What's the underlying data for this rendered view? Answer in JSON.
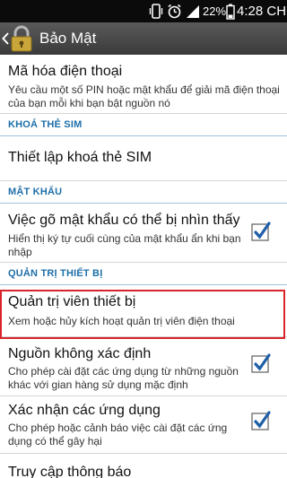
{
  "status_bar": {
    "battery": "22%",
    "time": "4:28 CH"
  },
  "action_bar": {
    "title": "Bảo Mật"
  },
  "items": {
    "encrypt": {
      "title": "Mã hóa điện thoại",
      "subtitle": "Yêu cầu một số PIN hoặc mật khẩu để giải mã điện thoại của bạn mỗi khi bạn bật nguồn nó"
    },
    "sim_header": "KHOÁ THẺ SIM",
    "sim_lock": {
      "title": "Thiết lập khoá thẻ SIM"
    },
    "password_header": "MẬT KHẨU",
    "visible_password": {
      "title": "Việc gõ mật khẩu có thể bị nhìn thấy",
      "subtitle": "Hiển thị ký tự cuối cùng của mật khẩu ẩn khi bạn nhập",
      "checked": true
    },
    "admin_header": "QUẢN TRỊ THIẾT BỊ",
    "device_admins": {
      "title": "Quản trị viên thiết bị",
      "subtitle": "Xem hoặc hủy kích hoạt quản trị viên điện thoại"
    },
    "unknown_sources": {
      "title": "Nguồn không xác định",
      "subtitle": "Cho phép cài đặt các ứng dụng từ những nguồn khác với gian hàng sử dụng mặc định",
      "checked": true
    },
    "verify_apps": {
      "title": "Xác nhận các ứng dụng",
      "subtitle": "Cho phép hoặc cảnh báo việc cài đặt các ứng dụng có thể gây hại",
      "checked": true
    },
    "notification_access": {
      "title": "Truy cập thông báo"
    }
  },
  "colors": {
    "section_text": "#1d6fa8",
    "highlight_border": "#d9242b",
    "check_blue": "#1e5fa8"
  }
}
